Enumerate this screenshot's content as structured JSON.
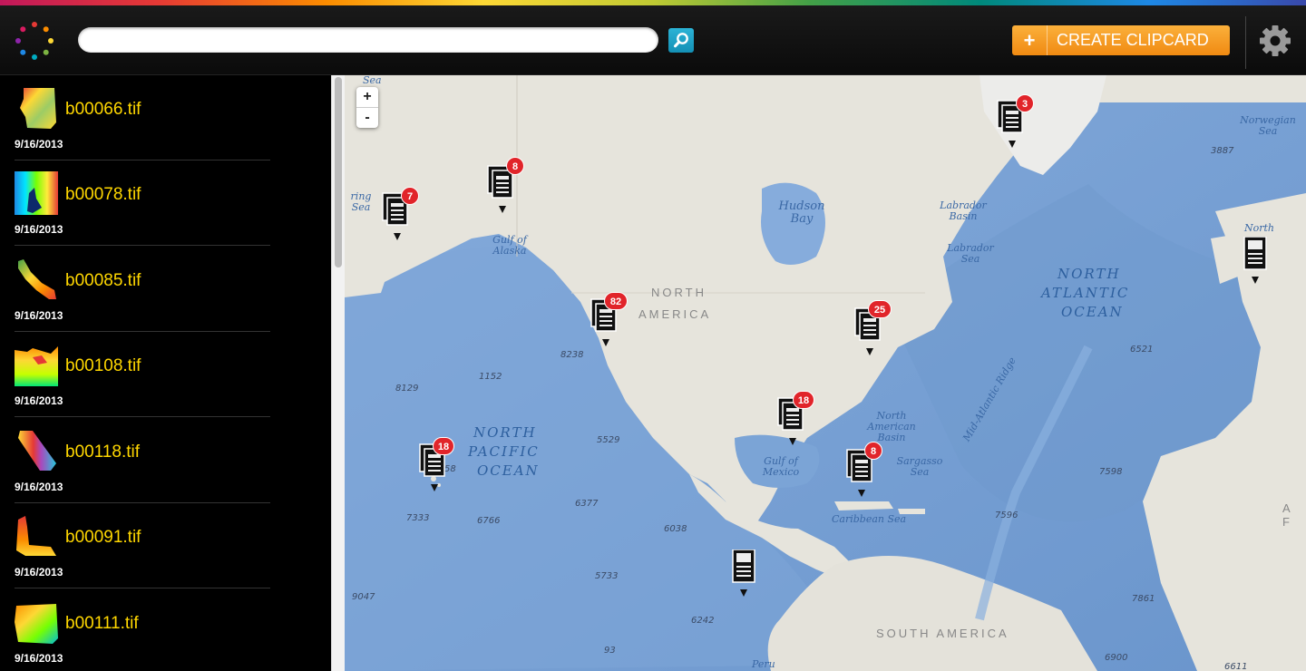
{
  "header": {
    "search_value": "",
    "create_button_plus": "+",
    "create_button_label": "CREATE CLIPCARD"
  },
  "files": [
    {
      "name": "b00066.tif",
      "date": "9/16/2013"
    },
    {
      "name": "b00078.tif",
      "date": "9/16/2013"
    },
    {
      "name": "b00085.tif",
      "date": "9/16/2013"
    },
    {
      "name": "b00108.tif",
      "date": "9/16/2013"
    },
    {
      "name": "b00118.tif",
      "date": "9/16/2013"
    },
    {
      "name": "b00091.tif",
      "date": "9/16/2013"
    },
    {
      "name": "b00111.tif",
      "date": "9/16/2013"
    }
  ],
  "map": {
    "zoom_in": "+",
    "zoom_out": "-",
    "clusters": [
      "7",
      "8",
      "3",
      "82",
      "25",
      "18",
      "18",
      "8"
    ],
    "labels": {
      "north_america_1": "NORTH",
      "north_america_2": "AMERICA",
      "south_america": "SOUTH AMERICA",
      "north_pacific_1": "NORTH",
      "north_pacific_2": "PACIFIC",
      "north_pacific_3": "OCEAN",
      "north_atlantic_1": "NORTH",
      "north_atlantic_2": "ATLANTIC",
      "north_atlantic_3": "OCEAN",
      "hudson_bay": "Hudson Bay",
      "gulf_of_alaska": "Gulf of Alaska",
      "gulf_of_mexico": "Gulf of Mexico",
      "caribbean_sea": "Caribbean Sea",
      "sargasso_sea": "Sargasso Sea",
      "labrador_basin": "Labrador Basin",
      "labrador_sea": "Labrador Sea",
      "norwegian_sea": "Norwegian Sea",
      "na_basin": "North American Basin",
      "mid_atlantic_ridge": "Mid-Atlantic Ridge",
      "bering_sea": "ring Sea",
      "sea_top": "Sea",
      "north_right": "North",
      "peru": "Peru",
      "af": "A F"
    },
    "depths": [
      "3887",
      "1152",
      "8238",
      "8129",
      "5529",
      "6377",
      "6038",
      "7333",
      "6766",
      "5733",
      "9047",
      "6242",
      "93",
      "6521",
      "7598",
      "7596",
      "7861",
      "6900",
      "6611",
      "58"
    ]
  }
}
